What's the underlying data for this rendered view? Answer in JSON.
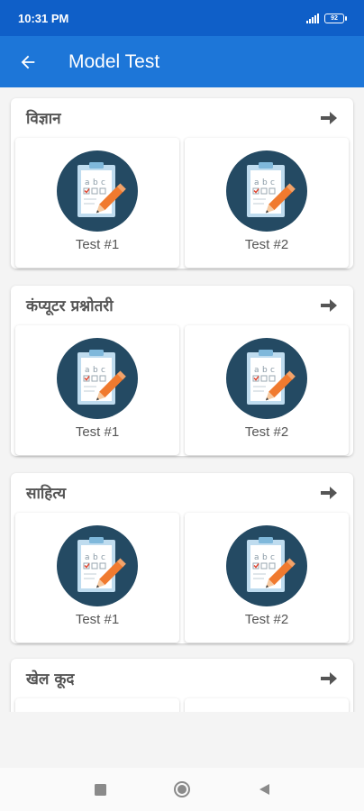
{
  "status_bar": {
    "time": "10:31 PM",
    "battery": "92"
  },
  "app_bar": {
    "title": "Model Test",
    "back_icon": "arrow-left-icon"
  },
  "colors": {
    "status_bar": "#0f5fc8",
    "app_bar": "#1d76d8",
    "icon_circle": "#244a63",
    "pencil": "#f07a2f"
  },
  "sections": [
    {
      "title": "विज्ञान",
      "tests": [
        {
          "label": "Test #1"
        },
        {
          "label": "Test #2"
        }
      ]
    },
    {
      "title": "कंप्यूटर प्रश्नोतरी",
      "tests": [
        {
          "label": "Test #1"
        },
        {
          "label": "Test #2"
        }
      ]
    },
    {
      "title": "साहित्य",
      "tests": [
        {
          "label": "Test #1"
        },
        {
          "label": "Test #2"
        }
      ]
    },
    {
      "title": "खेल कूद",
      "tests": []
    }
  ],
  "nav_bar": {
    "icons": [
      "square-icon",
      "circle-icon",
      "triangle-back-icon"
    ]
  }
}
